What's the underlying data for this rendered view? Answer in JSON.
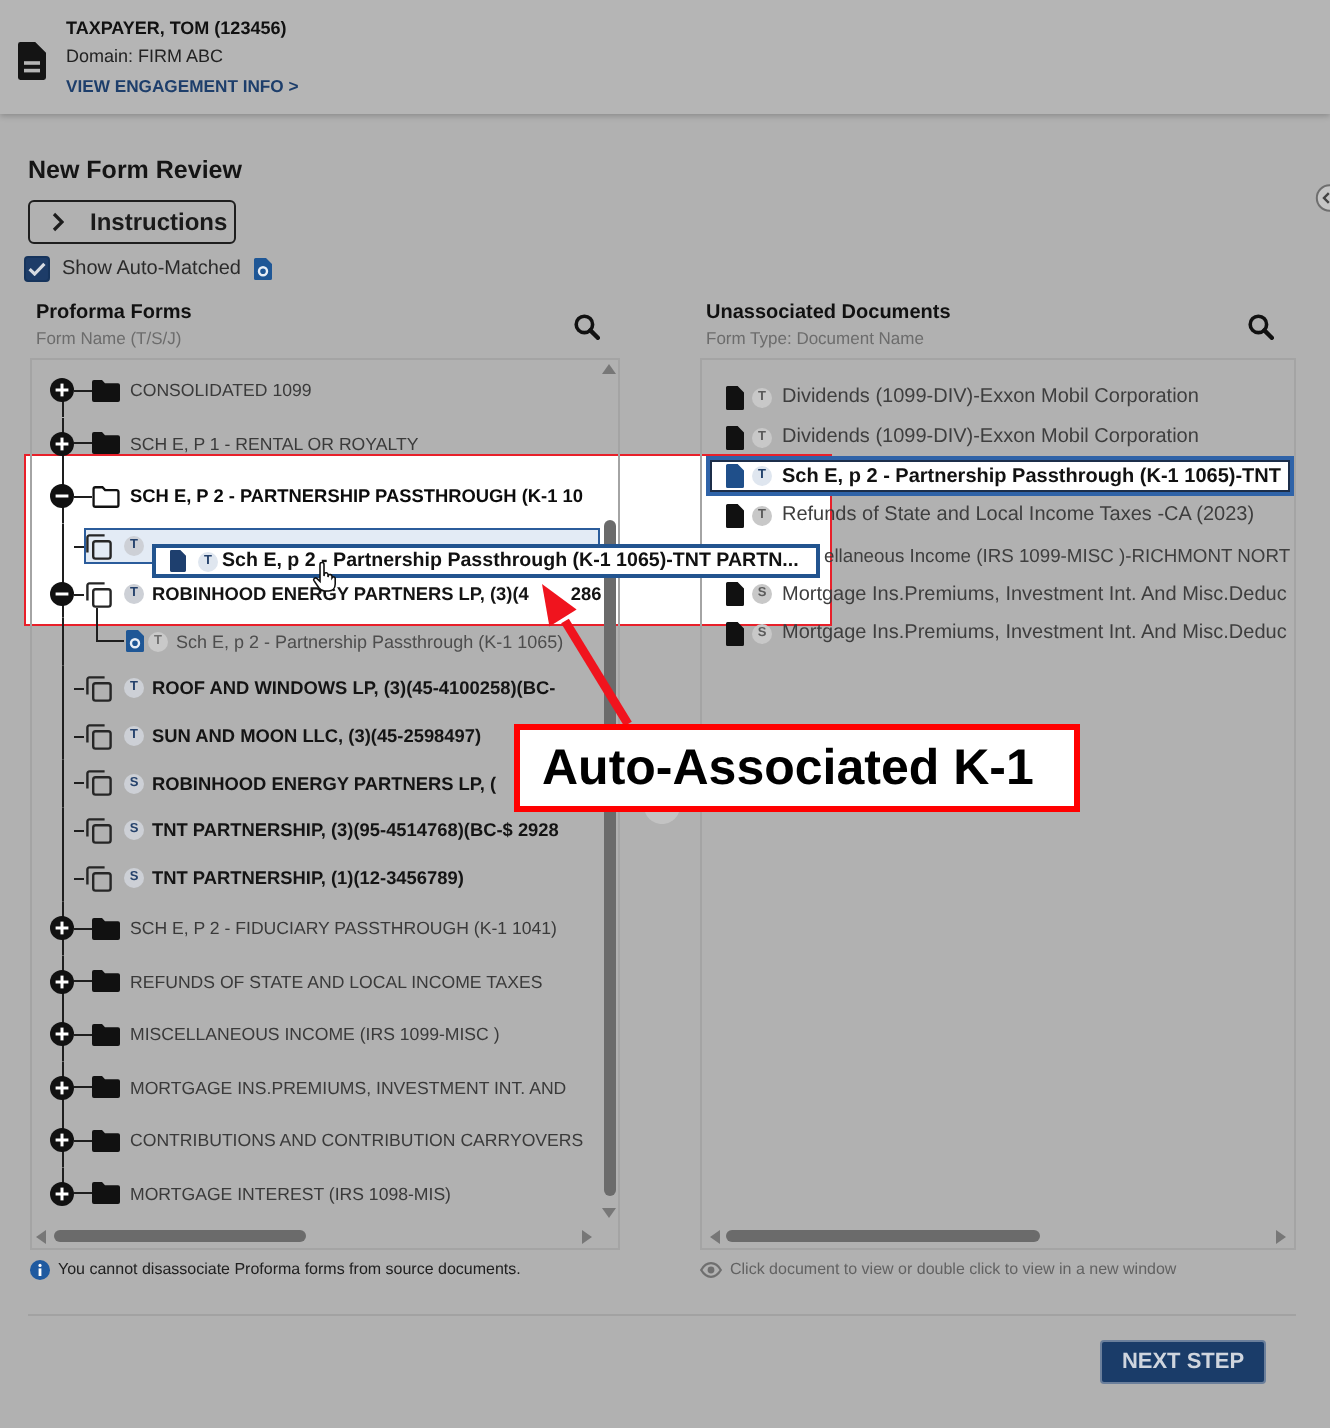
{
  "header": {
    "name": "TAXPAYER, TOM (123456)",
    "domain": "Domain: FIRM ABC",
    "link": "VIEW ENGAGEMENT INFO >"
  },
  "page_title": "New Form Review",
  "instructions": {
    "label": "Instructions",
    "expanded": false
  },
  "show_auto_matched": {
    "label": "Show Auto-Matched",
    "checked": true
  },
  "proforma_panel": {
    "title": "Proforma Forms",
    "subtitle": "Form Name (T/S/J)",
    "tree": [
      {
        "kind": "folder",
        "label": "CONSOLIDATED 1099",
        "expanded": false,
        "selected": false
      },
      {
        "kind": "folder",
        "label": "SCH E, P 1 - RENTAL OR ROYALTY",
        "expanded": false,
        "selected": false
      },
      {
        "kind": "folder",
        "label": "SCH E, P 2 - PARTNERSHIP PASSTHROUGH (K-1 10",
        "expanded": true,
        "selected": false,
        "children": [
          {
            "kind": "form",
            "badge": "T",
            "selected": true
          },
          {
            "kind": "form",
            "badge": "T",
            "label": "ROBINHOOD ENERGY PARTNERS LP, (3)(4",
            "label_tail": "286",
            "expanded": true,
            "selected": false,
            "children": [
              {
                "kind": "document",
                "badge": "T",
                "label": "Sch E, p 2 - Partnership Passthrough (K-1 1065)",
                "selected": false
              }
            ]
          },
          {
            "kind": "form",
            "badge": "T",
            "label": "ROOF AND WINDOWS LP, (3)(45-4100258)(BC-",
            "selected": false
          },
          {
            "kind": "form",
            "badge": "T",
            "label": "SUN AND MOON LLC, (3)(45-2598497)",
            "selected": false
          },
          {
            "kind": "form",
            "badge": "S",
            "label": "ROBINHOOD ENERGY PARTNERS LP, (",
            "selected": false
          },
          {
            "kind": "form",
            "badge": "S",
            "label": "TNT PARTNERSHIP, (3)(95-4514768)(BC-$ 2928",
            "selected": false
          },
          {
            "kind": "form",
            "badge": "S",
            "label": "TNT PARTNERSHIP, (1)(12-3456789)",
            "selected": false
          }
        ]
      },
      {
        "kind": "folder",
        "label": "SCH E, P 2 - FIDUCIARY PASSTHROUGH (K-1 1041)",
        "expanded": false,
        "selected": false
      },
      {
        "kind": "folder",
        "label": "REFUNDS OF STATE AND LOCAL INCOME TAXES",
        "expanded": false,
        "selected": false
      },
      {
        "kind": "folder",
        "label": "MISCELLANEOUS INCOME (IRS 1099-MISC )",
        "expanded": false,
        "selected": false
      },
      {
        "kind": "folder",
        "label": "MORTGAGE INS.PREMIUMS, INVESTMENT INT. AND",
        "expanded": false,
        "selected": false
      },
      {
        "kind": "folder",
        "label": "CONTRIBUTIONS AND CONTRIBUTION CARRYOVERS",
        "expanded": false,
        "selected": false
      },
      {
        "kind": "folder",
        "label": "MORTGAGE INTEREST (IRS 1098-MIS)",
        "expanded": false,
        "selected": false
      }
    ],
    "note": "You cannot disassociate Proforma forms from source documents."
  },
  "documents_panel": {
    "title": "Unassociated Documents",
    "subtitle": "Form Type: Document Name",
    "documents": [
      {
        "badge": "T",
        "label": "Dividends (1099-DIV)-Exxon Mobil Corporation",
        "selected": false,
        "covered": false
      },
      {
        "badge": "T",
        "label": "Dividends (1099-DIV)-Exxon Mobil Corporation",
        "selected": false,
        "covered": false
      },
      {
        "badge": "T",
        "label": "Sch E, p 2 - Partnership Passthrough (K-1 1065)-TNT",
        "selected": true,
        "covered": false
      },
      {
        "badge": "T",
        "label": "Refunds of State and Local Income Taxes -CA (2023)",
        "selected": false,
        "covered": false
      },
      {
        "label": "ellaneous Income (IRS 1099-MISC )-RICHMONT NORT",
        "selected": false,
        "covered": true
      },
      {
        "badge": "S",
        "label": "Mortgage Ins.Premiums, Investment Int. And Misc.Deduc",
        "selected": false,
        "covered": false
      },
      {
        "badge": "S",
        "label": "Mortgage Ins.Premiums, Investment Int. And Misc.Deduc",
        "selected": false,
        "covered": false
      }
    ],
    "note": "Click document to view or double click to view in a new window"
  },
  "next_button": "NEXT STEP",
  "drag_preview": {
    "badge": "T",
    "label": "Sch E, p 2 - Partnership Passthrough (K-1 1065)-TNT PARTN..."
  },
  "callout": "Auto-Associated K-1"
}
